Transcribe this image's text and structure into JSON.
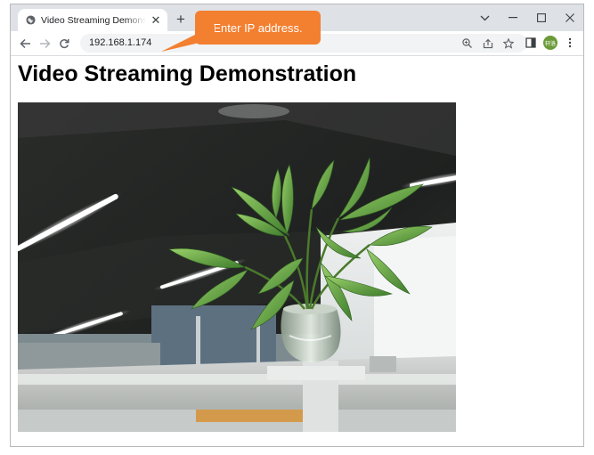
{
  "browser": {
    "tab": {
      "title": "Video Streaming Demonstration",
      "favicon_icon": "globe-icon",
      "close_label": "✕"
    },
    "new_tab_label": "+",
    "window_controls": {
      "tab_search_label": "⌵",
      "minimize_label": "–",
      "maximize_label": "☐",
      "close_label": "✕"
    },
    "toolbar": {
      "back_icon": "arrow-left-icon",
      "forward_icon": "arrow-right-icon",
      "reload_icon": "reload-icon",
      "url": "192.168.1.174",
      "zoom_icon": "zoom-icon",
      "share_icon": "share-icon",
      "bookmark_icon": "star-icon",
      "side_panel_icon": "side-panel-icon",
      "profile_initials": "轩洛",
      "profile_color": "#6a9b38",
      "menu_icon": "kebab-menu-icon"
    }
  },
  "annotation": {
    "text": "Enter IP address.",
    "color": "#f37f30"
  },
  "page": {
    "heading": "Video Streaming Demonstration",
    "video_description_icon": "video-stream-frame"
  }
}
